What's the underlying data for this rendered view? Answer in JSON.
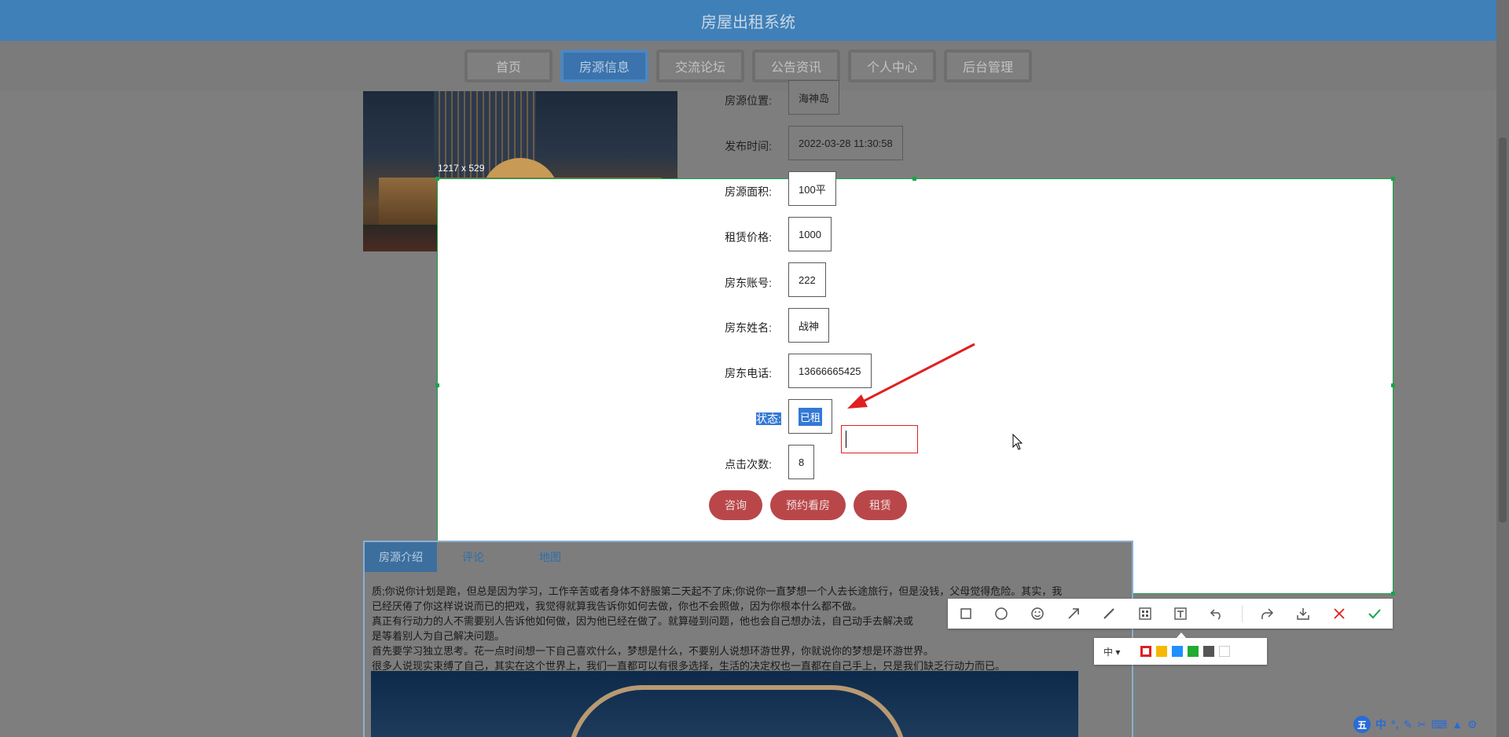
{
  "app": {
    "title": "房屋出租系统"
  },
  "nav": {
    "items": [
      {
        "label": "首页",
        "active": false
      },
      {
        "label": "房源信息",
        "active": true
      },
      {
        "label": "交流论坛",
        "active": false
      },
      {
        "label": "公告资讯",
        "active": false
      },
      {
        "label": "个人中心",
        "active": false
      },
      {
        "label": "后台管理",
        "active": false
      }
    ]
  },
  "details": {
    "location": {
      "label": "房源位置:",
      "value": "海神岛"
    },
    "published": {
      "label": "发布时间:",
      "value": "2022-03-28 11:30:58"
    },
    "area": {
      "label": "房源面积:",
      "value": "100平"
    },
    "price": {
      "label": "租赁价格:",
      "value": "1000"
    },
    "owner_account": {
      "label": "房东账号:",
      "value": "222"
    },
    "owner_name": {
      "label": "房东姓名:",
      "value": "战神"
    },
    "owner_phone": {
      "label": "房东电话:",
      "value": "13666665425"
    },
    "status": {
      "label": "状态:",
      "value": "已租"
    },
    "clicks": {
      "label": "点击次数:",
      "value": "8"
    }
  },
  "actions": {
    "consult": "咨询",
    "book_view": "预约看房",
    "rent": "租赁"
  },
  "tabs": [
    {
      "label": "房源介绍",
      "active": true
    },
    {
      "label": "评论",
      "active": false
    },
    {
      "label": "地图",
      "active": false
    }
  ],
  "intro": {
    "lines": [
      "质;你说你计划是跑，但总是因为学习，工作辛苦或者身体不舒服第二天起不了床;你说你一直梦想一个人去长途旅行，但是没钱，父母觉得危险。其实，我",
      "已经厌倦了你这样说说而已的把戏，我觉得就算我告诉你如何去做，你也不会照做，因为你根本什么都不做。",
      "真正有行动力的人不需要别人告诉他如何做，因为他已经在做了。就算碰到问题，他也会自己想办法，自己动手去解决或",
      "是等着别人为自己解决问题。",
      "首先要学习独立思考。花一点时间想一下自己喜欢什么，梦想是什么，不要别人说想环游世界，你就说你的梦想是环游世界。",
      "很多人说现实束缚了自己，其实在这个世界上，我们一直都可以有很多选择，生活的决定权也一直都在自己手上，只是我们缺乏行动力而已。"
    ]
  },
  "screenshot_tool": {
    "size_label": "1217 x 529",
    "font_size_option": "中 ▾",
    "tools": [
      "rect-icon",
      "ellipse-icon",
      "emoji-icon",
      "arrow-icon",
      "line-icon",
      "mosaic-icon",
      "text-icon",
      "undo-icon",
      "share-icon",
      "download-icon",
      "cancel-icon",
      "confirm-icon"
    ],
    "colors": [
      "#e02020",
      "#f5b800",
      "#1e90ff",
      "#22aa33",
      "#555555",
      "#ffffff"
    ]
  },
  "ime": {
    "lang": "中"
  }
}
